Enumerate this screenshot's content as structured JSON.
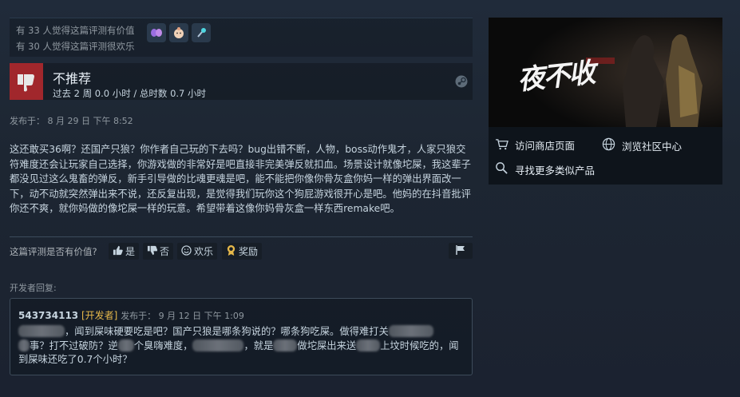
{
  "helpful": {
    "helpful_count_text": "有 33 人觉得这篇评测有价值",
    "funny_count_text": "有 30 人觉得这篇评测很欢乐",
    "awards": [
      "heart-award-icon",
      "baby-award-icon",
      "torch-award-icon"
    ]
  },
  "verdict": {
    "title": "不推荐",
    "hours": "过去 2 周 0.0 小时 / 总时数 0.7 小时"
  },
  "posted": "发布于： 8 月 29 日 下午 8:52",
  "review_text": "这还敢买36啊？还国产只狼？你作者自己玩的下去吗？bug出错不断，人物，boss动作鬼才，人家只狼交符难度还会让玩家自己选择，你游戏做的非常好是吧直接非完美弹反就扣血。场景设计就像坨屎，我这辈子都没见过这么鬼畜的弹反，新手引导做的比魂更魂是吧，能不能把你像你骨灰盒你妈一样的弹出界面改一下，动不动就突然弹出来不说，还反复出现，是觉得我们玩你这个狗屁游戏很开心是吧。他妈的在抖音批评你还不爽，就你妈做的像坨屎一样的玩意。希望带着这像你妈骨灰盒一样东西remake吧。",
  "vote": {
    "question": "这篇评测是否有价值?",
    "yes": "是",
    "no": "否",
    "funny": "欢乐",
    "award": "奖励"
  },
  "developer": {
    "label": "开发者回复:",
    "name": "543734113",
    "tag": "[开发者]",
    "date": "发布于：  9 月 12 日 下午 1:09",
    "text_parts": [
      "，闻到屎味硬要吃是吧？国产只狼是哪条狗说的？哪条狗吃屎。做得难打关",
      "事？打不过破防？逆",
      "个臭嗨难度，",
      "，就是",
      "做坨屎出来送",
      "上坟时候吃的，闻到屎味还吃了0.7个小时？"
    ]
  },
  "side": {
    "banner_title": "夜不收",
    "links": {
      "store": "访问商店页面",
      "community": "浏览社区中心",
      "similar": "寻找更多类似产品"
    }
  },
  "colors": {
    "background": "#1b2838",
    "not_recommended": "#a1272c",
    "dev_tag": "#e6b84a"
  }
}
